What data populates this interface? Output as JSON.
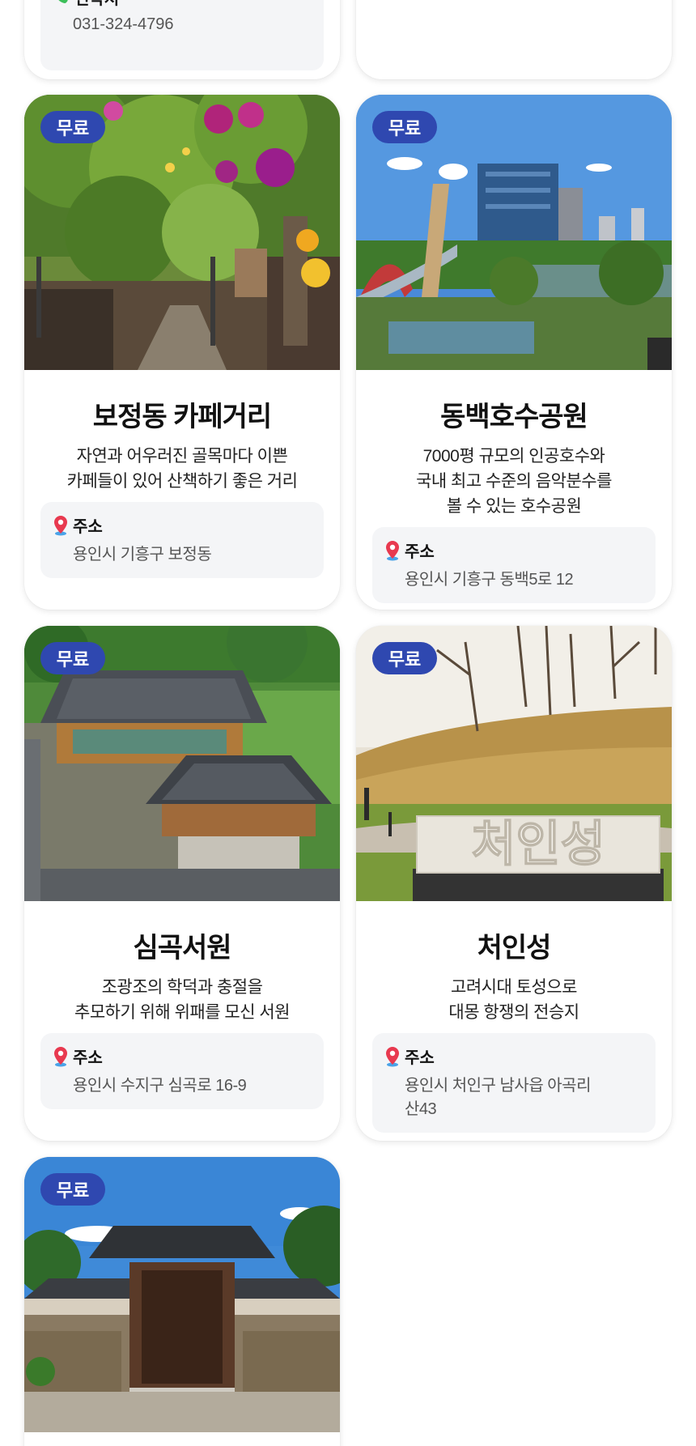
{
  "cards": [
    {
      "contact": {
        "label": "연락처",
        "value": "031-324-4796"
      }
    },
    {},
    {
      "badge": "무료",
      "title": "보정동 카페거리",
      "desc": [
        "자연과 어우러진 골목마다 이쁜",
        "카페들이 있어 산책하기 좋은 거리"
      ],
      "address": {
        "label": "주소",
        "value": "용인시 기흥구 보정동"
      }
    },
    {
      "badge": "무료",
      "title": "동백호수공원",
      "desc": [
        "7000평 규모의 인공호수와",
        "국내 최고 수준의 음악분수를",
        "볼 수 있는 호수공원"
      ],
      "address": {
        "label": "주소",
        "value": "용인시 기흥구 동백5로 12"
      }
    },
    {
      "badge": "무료",
      "title": "심곡서원",
      "desc": [
        "조광조의 학덕과 충절을",
        "추모하기 위해 위패를 모신 서원"
      ],
      "address": {
        "label": "주소",
        "value": "용인시 수지구 심곡로 16-9"
      }
    },
    {
      "badge": "무료",
      "title": "처인성",
      "desc": [
        "고려시대 토성으로",
        "대몽 항쟁의 전승지"
      ],
      "address": {
        "label": "주소",
        "value_lines": [
          "용인시 처인구 남사읍 아곡리",
          "산43"
        ]
      },
      "sign_text": "처인성"
    },
    {
      "badge": "무료"
    }
  ],
  "colors": {
    "badge": "#2f48b0",
    "info_bg": "#f4f5f7",
    "pin": "#e8394f",
    "phone": "#3cbf5a"
  },
  "icons": [
    "phone-icon",
    "location-pin-icon"
  ]
}
